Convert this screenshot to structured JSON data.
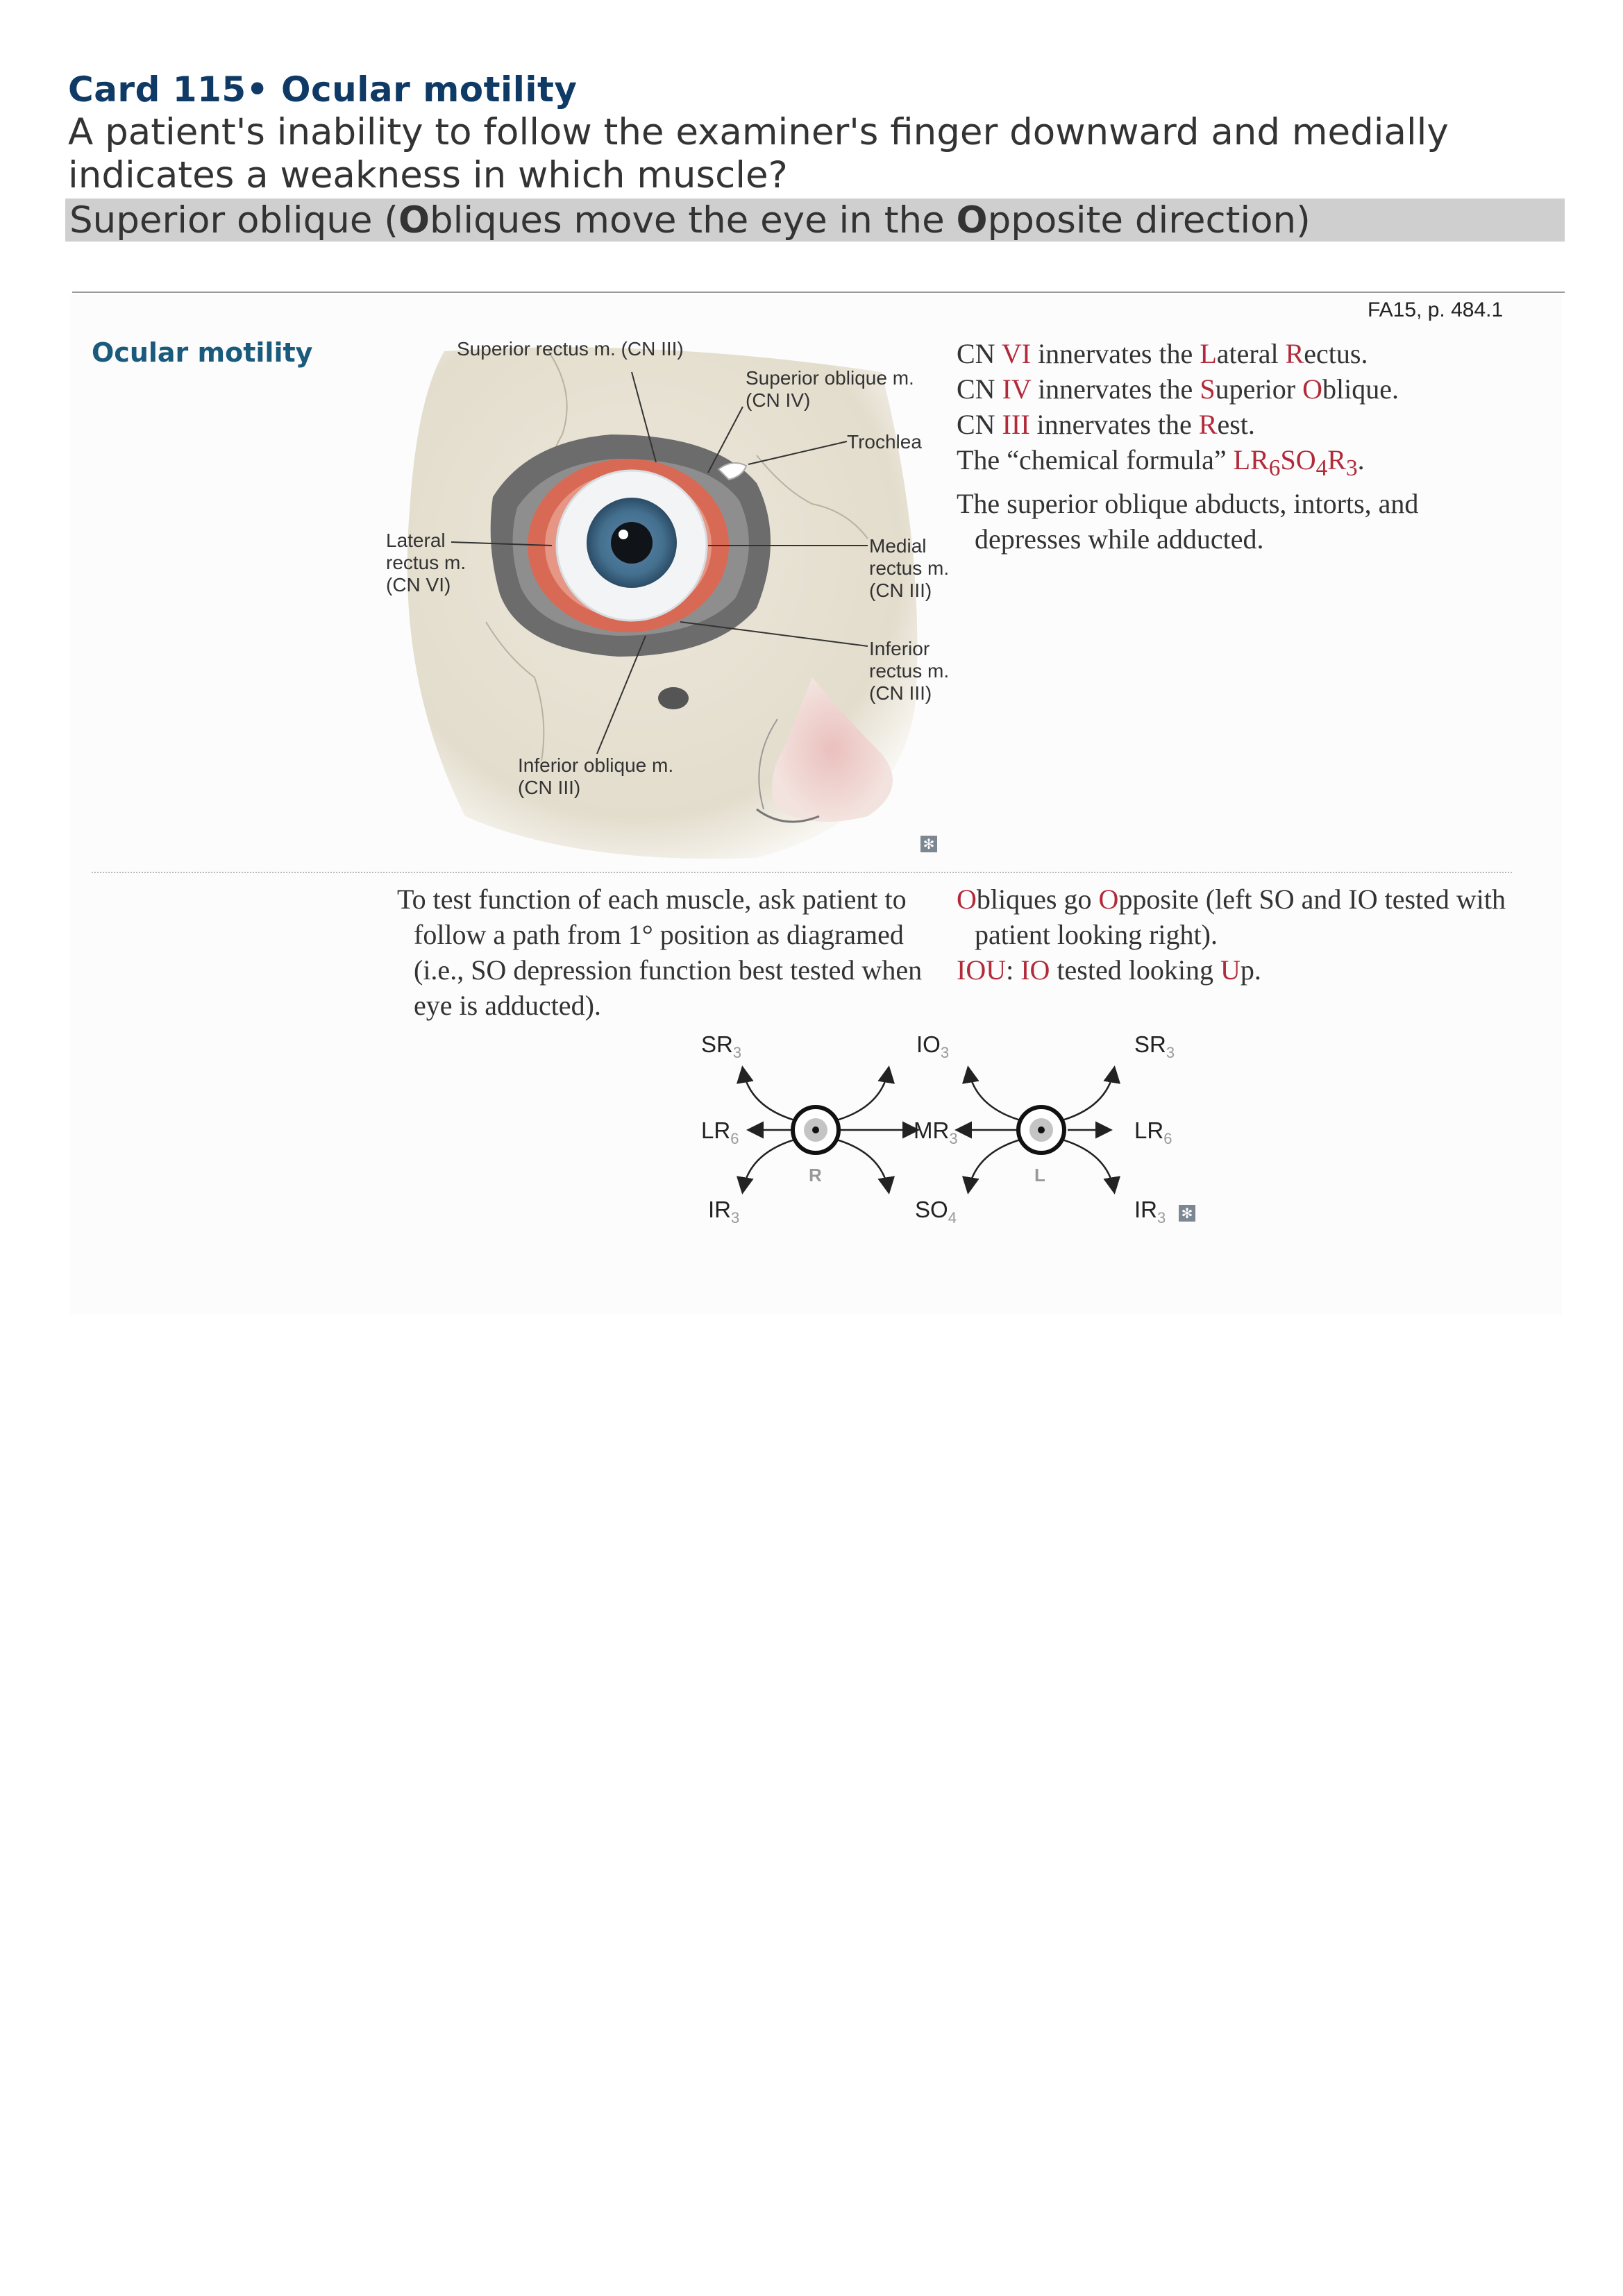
{
  "card": {
    "title": "Card 115• Ocular motility",
    "question": "A patient's inability to follow the examiner's finger downward and medially indicates a weakness in which muscle?",
    "answer_parts": [
      "Superior oblique (",
      "O",
      "bliques move the eye in the ",
      "O",
      "pposite direction)"
    ]
  },
  "source": {
    "reference": "FA15, p. 484.1"
  },
  "section": {
    "heading": "Ocular motility"
  },
  "figure_labels": {
    "superior_rectus": "Superior rectus m. (CN III)",
    "superior_oblique_1": "Superior oblique m.",
    "superior_oblique_2": "(CN IV)",
    "trochlea": "Trochlea",
    "lateral_1": "Lateral",
    "lateral_2": "rectus m.",
    "lateral_3": "(CN VI)",
    "medial_1": "Medial",
    "medial_2": "rectus m.",
    "medial_3": "(CN III)",
    "inferior_rectus_1": "Inferior",
    "inferior_rectus_2": "rectus m.",
    "inferior_rectus_3": "(CN III)",
    "inferior_oblique_1": "Inferior oblique m.",
    "inferior_oblique_2": "(CN III)"
  },
  "facts": {
    "line1": [
      "CN ",
      "VI",
      " innervates the ",
      "L",
      "ateral ",
      "R",
      "ectus."
    ],
    "line2": [
      "CN ",
      "IV",
      " innervates the ",
      "S",
      "uperior ",
      "O",
      "blique."
    ],
    "line3": [
      "CN ",
      "III",
      " innervates the ",
      "R",
      "est."
    ],
    "line4": [
      "The “chemical formula” ",
      "LR",
      "6",
      "SO",
      "4",
      "R",
      "3",
      "."
    ],
    "line5": "The superior oblique abducts, intorts, and",
    "line6": "depresses while adducted."
  },
  "test_text": {
    "line1": "To test function of each muscle, ask patient to",
    "line2": "follow a path from 1° position as diagramed",
    "line3": "(i.e., SO depression function best tested when",
    "line4": "eye is adducted)."
  },
  "oblique_text": {
    "line1": [
      "O",
      "bliques go ",
      "O",
      "pposite (left SO and IO tested with"
    ],
    "line2": "patient looking right).",
    "line3": [
      "IOU",
      ": ",
      "IO",
      " tested looking ",
      "U",
      "p."
    ]
  },
  "motility_diagram": {
    "right_eye": "R",
    "left_eye": "L",
    "sr_r": [
      "SR",
      "3"
    ],
    "lr_r": [
      "LR",
      "6"
    ],
    "ir_r": [
      "IR",
      "3"
    ],
    "io": [
      "IO",
      "3"
    ],
    "mr": [
      "MR",
      "3"
    ],
    "so": [
      "SO",
      "4"
    ],
    "sr_l": [
      "SR",
      "3"
    ],
    "lr_l": [
      "LR",
      "6"
    ],
    "ir_l": [
      "IR",
      "3"
    ]
  },
  "colors": {
    "title": "#0f3a66",
    "heading": "#1a5a7c",
    "emphasis_red": "#b22a3a",
    "answer_bar": "#cfcfcf"
  }
}
